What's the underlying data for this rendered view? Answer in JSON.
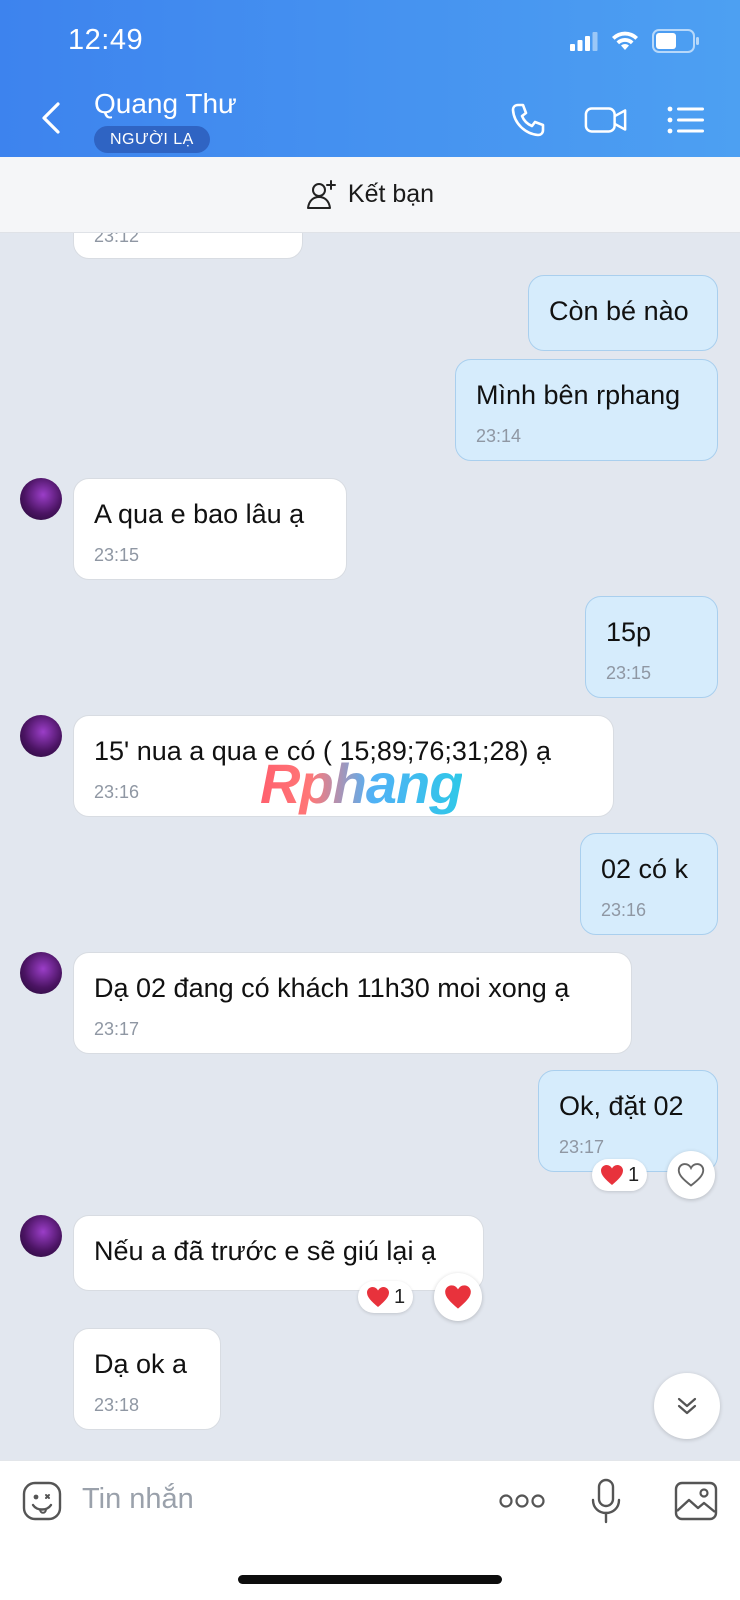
{
  "status_bar": {
    "time": "12:49"
  },
  "header": {
    "contact_name": "Quang Thư",
    "badge": "NGƯỜI LẠ",
    "icons": [
      "back-chevron-icon",
      "phone-icon",
      "video-call-icon",
      "menu-list-icon"
    ]
  },
  "friend_bar": {
    "label": "Kết bạn",
    "icon": "add-user-icon"
  },
  "watermark": "Rphang",
  "messages": [
    {
      "side": "in",
      "text": "",
      "time": "23:12"
    },
    {
      "side": "out",
      "text": "Còn bé nào",
      "time": ""
    },
    {
      "side": "out",
      "text": "Mình bên rphang",
      "time": "23:14"
    },
    {
      "side": "in",
      "text": "A qua e bao lâu ạ",
      "time": "23:15"
    },
    {
      "side": "out",
      "text": "15p",
      "time": "23:15"
    },
    {
      "side": "in",
      "text": "15' nua a qua e có ( 15;89;76;31;28) ạ",
      "time": "23:16"
    },
    {
      "side": "out",
      "text": "02 có k",
      "time": "23:16"
    },
    {
      "side": "in",
      "text": "Dạ 02 đang có khách 11h30 moi xong ạ",
      "time": "23:17"
    },
    {
      "side": "out",
      "text": "Ok, đặt 02",
      "time": "23:17",
      "reaction": {
        "emoji": "heart",
        "count": "1"
      }
    },
    {
      "side": "in",
      "text": "Nếu a đã trước e sẽ giú lại ạ",
      "time": "",
      "reaction": {
        "emoji": "heart",
        "count": "1"
      }
    },
    {
      "side": "in",
      "text": "Dạ ok a",
      "time": "23:18"
    }
  ],
  "input_bar": {
    "placeholder": "Tin nhắn",
    "icons": [
      "sticker-icon",
      "more-icon",
      "microphone-icon",
      "image-icon"
    ]
  },
  "colors": {
    "header_start": "#3d83ee",
    "header_end": "#4da0f2",
    "out_bubble": "#d6ecfc",
    "in_bubble": "#ffffff",
    "chat_bg": "#e2e7ef"
  }
}
